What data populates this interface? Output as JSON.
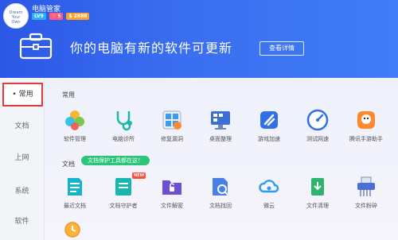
{
  "app": {
    "title": "电脑管家",
    "badges": [
      "LV9",
      "♡ 5",
      "$ 2888"
    ]
  },
  "banner": {
    "message": "你的电脑有新的软件可更新",
    "detail_button": "查看详情"
  },
  "sidebar": {
    "items": [
      {
        "label": "常用",
        "active": true
      },
      {
        "label": "文档",
        "active": false
      },
      {
        "label": "上网",
        "active": false
      },
      {
        "label": "系统",
        "active": false
      },
      {
        "label": "软件",
        "active": false
      }
    ]
  },
  "sections": {
    "common": {
      "title": "常用",
      "tools": [
        {
          "label": "软件管理",
          "icon": "software-manager-icon"
        },
        {
          "label": "电脑诊所",
          "icon": "pc-clinic-icon"
        },
        {
          "label": "修复漏洞",
          "icon": "patch-vulnerability-icon"
        },
        {
          "label": "桌面整理",
          "icon": "desktop-organize-icon"
        },
        {
          "label": "游戏加速",
          "icon": "game-accelerate-icon"
        },
        {
          "label": "测试网速",
          "icon": "speed-test-icon"
        },
        {
          "label": "腾讯手游助手",
          "icon": "mobile-game-assistant-icon"
        }
      ]
    },
    "docs": {
      "title": "文档",
      "tooltip": "文档保护工具都在这！",
      "new_tag": "NEW",
      "tools": [
        {
          "label": "最近文档",
          "icon": "recent-docs-icon"
        },
        {
          "label": "文档守护者",
          "icon": "doc-guardian-icon"
        },
        {
          "label": "文件解密",
          "icon": "file-decrypt-icon"
        },
        {
          "label": "文档找回",
          "icon": "doc-recover-icon"
        },
        {
          "label": "微云",
          "icon": "weiyun-icon"
        },
        {
          "label": "文件清理",
          "icon": "file-cleanup-icon"
        },
        {
          "label": "文件粉碎",
          "icon": "file-shred-icon"
        }
      ],
      "extra_icon": "clock-history-icon"
    }
  },
  "colors": {
    "header_start": "#2b58e6",
    "header_end": "#3f7cf5",
    "active_outline": "#e23b3b",
    "tooltip": "#2bc57a"
  }
}
